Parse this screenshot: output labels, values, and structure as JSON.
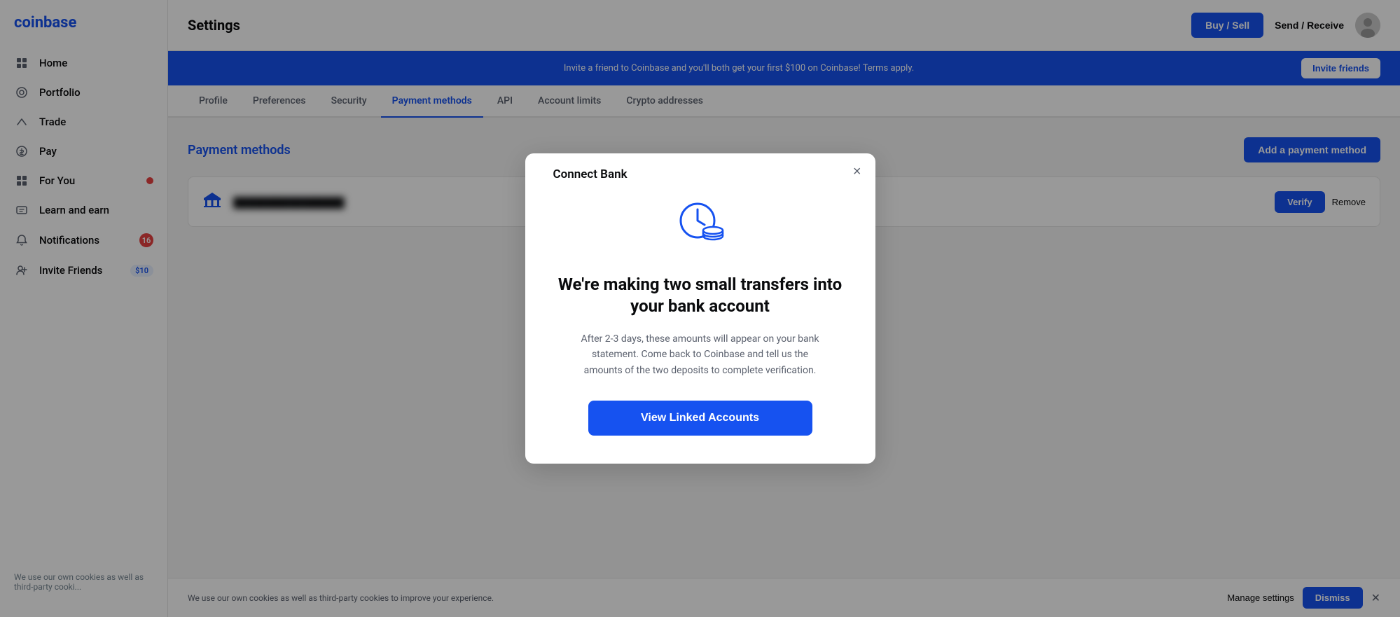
{
  "sidebar": {
    "logo": "coinbase",
    "items": [
      {
        "id": "home",
        "label": "Home",
        "icon": "⊞",
        "badge": null,
        "badge_dollar": null
      },
      {
        "id": "portfolio",
        "label": "Portfolio",
        "icon": "◎",
        "badge": null,
        "badge_dollar": null
      },
      {
        "id": "trade",
        "label": "Trade",
        "icon": "↗",
        "badge": null,
        "badge_dollar": null
      },
      {
        "id": "pay",
        "label": "Pay",
        "icon": "⊙",
        "badge": null,
        "badge_dollar": null
      },
      {
        "id": "for-you",
        "label": "For You",
        "icon": "⊞",
        "badge": "●",
        "badge_dollar": null
      },
      {
        "id": "learn-earn",
        "label": "Learn and earn",
        "icon": "⊞",
        "badge": null,
        "badge_dollar": null
      },
      {
        "id": "notifications",
        "label": "Notifications",
        "icon": "🔔",
        "badge": "16",
        "badge_dollar": null
      },
      {
        "id": "invite-friends",
        "label": "Invite Friends",
        "icon": "✦",
        "badge": null,
        "badge_dollar": "$10"
      }
    ],
    "cookie_text": "We use our own cookies as well as third-party cooki..."
  },
  "header": {
    "title": "Settings",
    "buy_sell_label": "Buy / Sell",
    "send_receive_label": "Send / Receive"
  },
  "banner": {
    "text": "Invite a friend to Coinbase and you'll both get your first $100 on Coinbase! Terms apply.",
    "button_label": "Invite friends"
  },
  "tabs": [
    {
      "id": "profile",
      "label": "Profile",
      "active": false
    },
    {
      "id": "preferences",
      "label": "Preferences",
      "active": false
    },
    {
      "id": "security",
      "label": "Security",
      "active": false
    },
    {
      "id": "payment-methods",
      "label": "Payment methods",
      "active": true
    },
    {
      "id": "api",
      "label": "API",
      "active": false
    },
    {
      "id": "account-limits",
      "label": "Account limits",
      "active": false
    },
    {
      "id": "crypto-addresses",
      "label": "Crypto addresses",
      "active": false
    }
  ],
  "payment_methods": {
    "section_title": "Payment methods",
    "add_button_label": "Add a payment method",
    "verify_label": "Verify",
    "remove_label": "Remove",
    "bank_name": "████████████████"
  },
  "cookie_bar": {
    "text": "We use our own cookies as well as third-party cookies to improve your experience.",
    "manage_label": "Manage settings",
    "dismiss_label": "Dismiss"
  },
  "modal": {
    "title": "Connect Bank",
    "close_label": "×",
    "heading": "We're making two small transfers into your bank account",
    "body": "After 2-3 days, these amounts will appear on your bank statement. Come back to Coinbase and tell us the amounts of the two deposits to complete verification.",
    "button_label": "View Linked Accounts",
    "icon_color": "#1652f0"
  }
}
